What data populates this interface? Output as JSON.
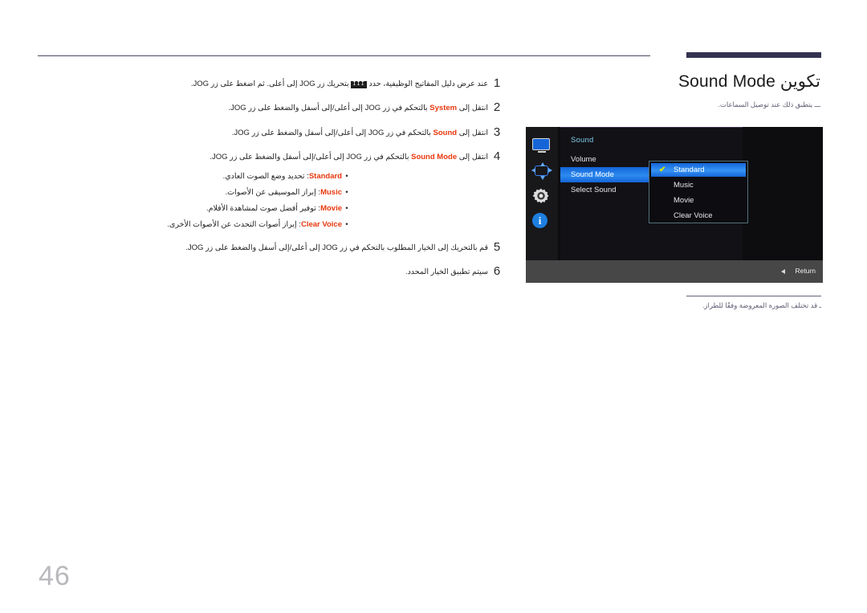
{
  "page": {
    "number": "46"
  },
  "header": {
    "title": "تكوين Sound Mode",
    "note": "ـــ يتطبق ذلك عند توصيل السماعات."
  },
  "footer_note": {
    "text": "ـ قد تختلف الصورة المعروضة وفقًا للطراز."
  },
  "steps": [
    {
      "number": "1",
      "text_before": "عند عرض دليل المفاتيح الوظيفية، حدد ",
      "glyph": "III",
      "text_after": " بتحريك زر JOG إلى أعلى. ثم اضغط على زر JOG."
    },
    {
      "number": "2",
      "text_before": "انتقل إلى ",
      "keyword": "System",
      "text_after": " بالتحكم في زر JOG إلى أعلى/إلى أسفل والضغط على زر JOG."
    },
    {
      "number": "3",
      "text_before": "انتقل إلى ",
      "keyword": "Sound",
      "text_after": " بالتحكم في زر JOG إلى أعلى/إلى أسفل والضغط على زر JOG."
    },
    {
      "number": "4",
      "text_before": "انتقل إلى ",
      "keyword": "Sound Mode",
      "text_after": " بالتحكم في زر JOG إلى أعلى/إلى أسفل والضغط على زر JOG."
    },
    {
      "number": "5",
      "text_before": "",
      "keyword": "",
      "text_after": "قم بالتحريك إلى الخيار المطلوب بالتحكم في زر JOG إلى أعلى/إلى أسفل والضغط على زر JOG."
    },
    {
      "number": "6",
      "text_before": "",
      "keyword": "",
      "text_after": "سيتم تطبيق الخيار المحدد."
    }
  ],
  "bullets": [
    {
      "dot": "•",
      "keyword": "Standard",
      "desc": ": تحديد وضع الصوت العادي."
    },
    {
      "dot": "•",
      "keyword": "Music",
      "desc": ": إبراز الموسيقى عن الأصوات."
    },
    {
      "dot": "•",
      "keyword": "Movie",
      "desc": ": توفير أفضل صوت لمشاهدة الأفلام."
    },
    {
      "dot": "•",
      "keyword": "Clear Voice",
      "desc": ": إبراز أصوات التحدث عن الأصوات الأخرى."
    }
  ],
  "osd": {
    "heading": "Sound",
    "icons": [
      {
        "name": "display-icon"
      },
      {
        "name": "position-icon"
      },
      {
        "name": "system-gear-icon"
      },
      {
        "name": "information-icon",
        "glyph": "i"
      }
    ],
    "menu_items": [
      {
        "label": "Volume",
        "selected": false
      },
      {
        "label": "Sound Mode",
        "selected": true
      },
      {
        "label": "Select Sound",
        "selected": false
      }
    ],
    "submenu": [
      {
        "label": "Standard",
        "selected": true,
        "check": "✔"
      },
      {
        "label": "Music",
        "selected": false,
        "check": ""
      },
      {
        "label": "Movie",
        "selected": false,
        "check": ""
      },
      {
        "label": "Clear Voice",
        "selected": false,
        "check": ""
      }
    ],
    "return_label": "Return"
  },
  "colors": {
    "accent_red": "#e8380d",
    "osd_blue": "#1565d8",
    "check_yellow": "#d8e70a",
    "rule_navy": "#333350"
  }
}
